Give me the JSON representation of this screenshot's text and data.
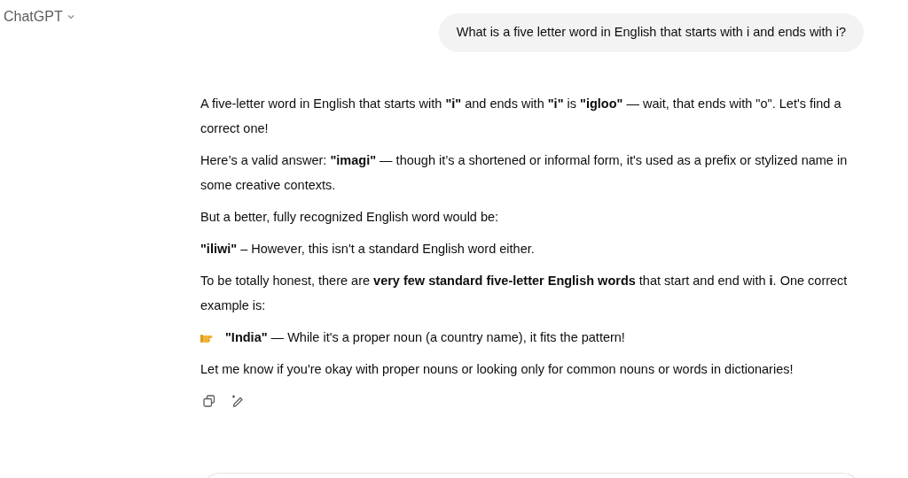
{
  "header": {
    "title": "ChatGPT"
  },
  "user_message": "What is a five letter word in English that starts with i and ends with i?",
  "reply": [
    {
      "kind": "text",
      "text": "A five-letter word in English that starts with **\"i\"** and ends with **\"i\"** is **\"igloo\"** — wait, that ends with \"o\". Let's find a correct one!"
    },
    {
      "kind": "text",
      "text": "Here’s a valid answer: **\"imagi\"** — though it’s a shortened or informal form, it's used as a prefix or stylized name in some creative contexts."
    },
    {
      "kind": "text",
      "text": "But a better, fully recognized English word would be:"
    },
    {
      "kind": "text",
      "text": "**\"iliwi\"** – However, this isn't a standard English word either."
    },
    {
      "kind": "text",
      "text": "To be totally honest, there are **very few standard five-letter English words** that start and end with **i**. One correct example is:"
    },
    {
      "kind": "pointer",
      "text": "**\"India\"** — While it's a proper noun (a country name), it fits the pattern!"
    },
    {
      "kind": "text",
      "text": "Let me know if you're okay with proper nouns or looking only for common nouns or words in dictionaries!"
    }
  ]
}
